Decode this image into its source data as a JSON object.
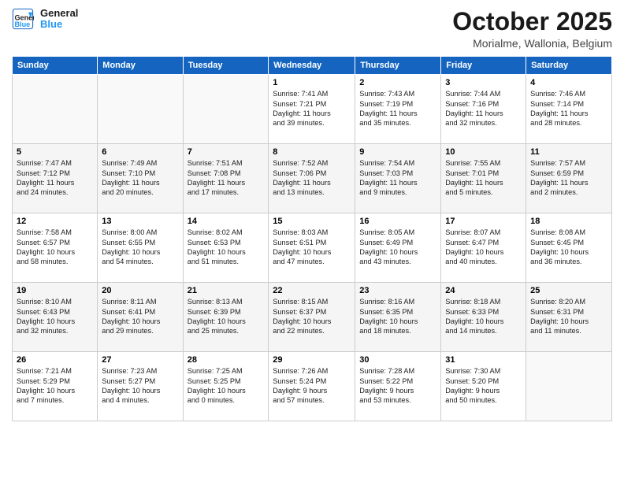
{
  "header": {
    "logo_line1": "General",
    "logo_line2": "Blue",
    "month": "October 2025",
    "location": "Morialme, Wallonia, Belgium"
  },
  "weekdays": [
    "Sunday",
    "Monday",
    "Tuesday",
    "Wednesday",
    "Thursday",
    "Friday",
    "Saturday"
  ],
  "weeks": [
    [
      {
        "day": "",
        "info": ""
      },
      {
        "day": "",
        "info": ""
      },
      {
        "day": "",
        "info": ""
      },
      {
        "day": "1",
        "info": "Sunrise: 7:41 AM\nSunset: 7:21 PM\nDaylight: 11 hours\nand 39 minutes."
      },
      {
        "day": "2",
        "info": "Sunrise: 7:43 AM\nSunset: 7:19 PM\nDaylight: 11 hours\nand 35 minutes."
      },
      {
        "day": "3",
        "info": "Sunrise: 7:44 AM\nSunset: 7:16 PM\nDaylight: 11 hours\nand 32 minutes."
      },
      {
        "day": "4",
        "info": "Sunrise: 7:46 AM\nSunset: 7:14 PM\nDaylight: 11 hours\nand 28 minutes."
      }
    ],
    [
      {
        "day": "5",
        "info": "Sunrise: 7:47 AM\nSunset: 7:12 PM\nDaylight: 11 hours\nand 24 minutes."
      },
      {
        "day": "6",
        "info": "Sunrise: 7:49 AM\nSunset: 7:10 PM\nDaylight: 11 hours\nand 20 minutes."
      },
      {
        "day": "7",
        "info": "Sunrise: 7:51 AM\nSunset: 7:08 PM\nDaylight: 11 hours\nand 17 minutes."
      },
      {
        "day": "8",
        "info": "Sunrise: 7:52 AM\nSunset: 7:06 PM\nDaylight: 11 hours\nand 13 minutes."
      },
      {
        "day": "9",
        "info": "Sunrise: 7:54 AM\nSunset: 7:03 PM\nDaylight: 11 hours\nand 9 minutes."
      },
      {
        "day": "10",
        "info": "Sunrise: 7:55 AM\nSunset: 7:01 PM\nDaylight: 11 hours\nand 5 minutes."
      },
      {
        "day": "11",
        "info": "Sunrise: 7:57 AM\nSunset: 6:59 PM\nDaylight: 11 hours\nand 2 minutes."
      }
    ],
    [
      {
        "day": "12",
        "info": "Sunrise: 7:58 AM\nSunset: 6:57 PM\nDaylight: 10 hours\nand 58 minutes."
      },
      {
        "day": "13",
        "info": "Sunrise: 8:00 AM\nSunset: 6:55 PM\nDaylight: 10 hours\nand 54 minutes."
      },
      {
        "day": "14",
        "info": "Sunrise: 8:02 AM\nSunset: 6:53 PM\nDaylight: 10 hours\nand 51 minutes."
      },
      {
        "day": "15",
        "info": "Sunrise: 8:03 AM\nSunset: 6:51 PM\nDaylight: 10 hours\nand 47 minutes."
      },
      {
        "day": "16",
        "info": "Sunrise: 8:05 AM\nSunset: 6:49 PM\nDaylight: 10 hours\nand 43 minutes."
      },
      {
        "day": "17",
        "info": "Sunrise: 8:07 AM\nSunset: 6:47 PM\nDaylight: 10 hours\nand 40 minutes."
      },
      {
        "day": "18",
        "info": "Sunrise: 8:08 AM\nSunset: 6:45 PM\nDaylight: 10 hours\nand 36 minutes."
      }
    ],
    [
      {
        "day": "19",
        "info": "Sunrise: 8:10 AM\nSunset: 6:43 PM\nDaylight: 10 hours\nand 32 minutes."
      },
      {
        "day": "20",
        "info": "Sunrise: 8:11 AM\nSunset: 6:41 PM\nDaylight: 10 hours\nand 29 minutes."
      },
      {
        "day": "21",
        "info": "Sunrise: 8:13 AM\nSunset: 6:39 PM\nDaylight: 10 hours\nand 25 minutes."
      },
      {
        "day": "22",
        "info": "Sunrise: 8:15 AM\nSunset: 6:37 PM\nDaylight: 10 hours\nand 22 minutes."
      },
      {
        "day": "23",
        "info": "Sunrise: 8:16 AM\nSunset: 6:35 PM\nDaylight: 10 hours\nand 18 minutes."
      },
      {
        "day": "24",
        "info": "Sunrise: 8:18 AM\nSunset: 6:33 PM\nDaylight: 10 hours\nand 14 minutes."
      },
      {
        "day": "25",
        "info": "Sunrise: 8:20 AM\nSunset: 6:31 PM\nDaylight: 10 hours\nand 11 minutes."
      }
    ],
    [
      {
        "day": "26",
        "info": "Sunrise: 7:21 AM\nSunset: 5:29 PM\nDaylight: 10 hours\nand 7 minutes."
      },
      {
        "day": "27",
        "info": "Sunrise: 7:23 AM\nSunset: 5:27 PM\nDaylight: 10 hours\nand 4 minutes."
      },
      {
        "day": "28",
        "info": "Sunrise: 7:25 AM\nSunset: 5:25 PM\nDaylight: 10 hours\nand 0 minutes."
      },
      {
        "day": "29",
        "info": "Sunrise: 7:26 AM\nSunset: 5:24 PM\nDaylight: 9 hours\nand 57 minutes."
      },
      {
        "day": "30",
        "info": "Sunrise: 7:28 AM\nSunset: 5:22 PM\nDaylight: 9 hours\nand 53 minutes."
      },
      {
        "day": "31",
        "info": "Sunrise: 7:30 AM\nSunset: 5:20 PM\nDaylight: 9 hours\nand 50 minutes."
      },
      {
        "day": "",
        "info": ""
      }
    ]
  ]
}
